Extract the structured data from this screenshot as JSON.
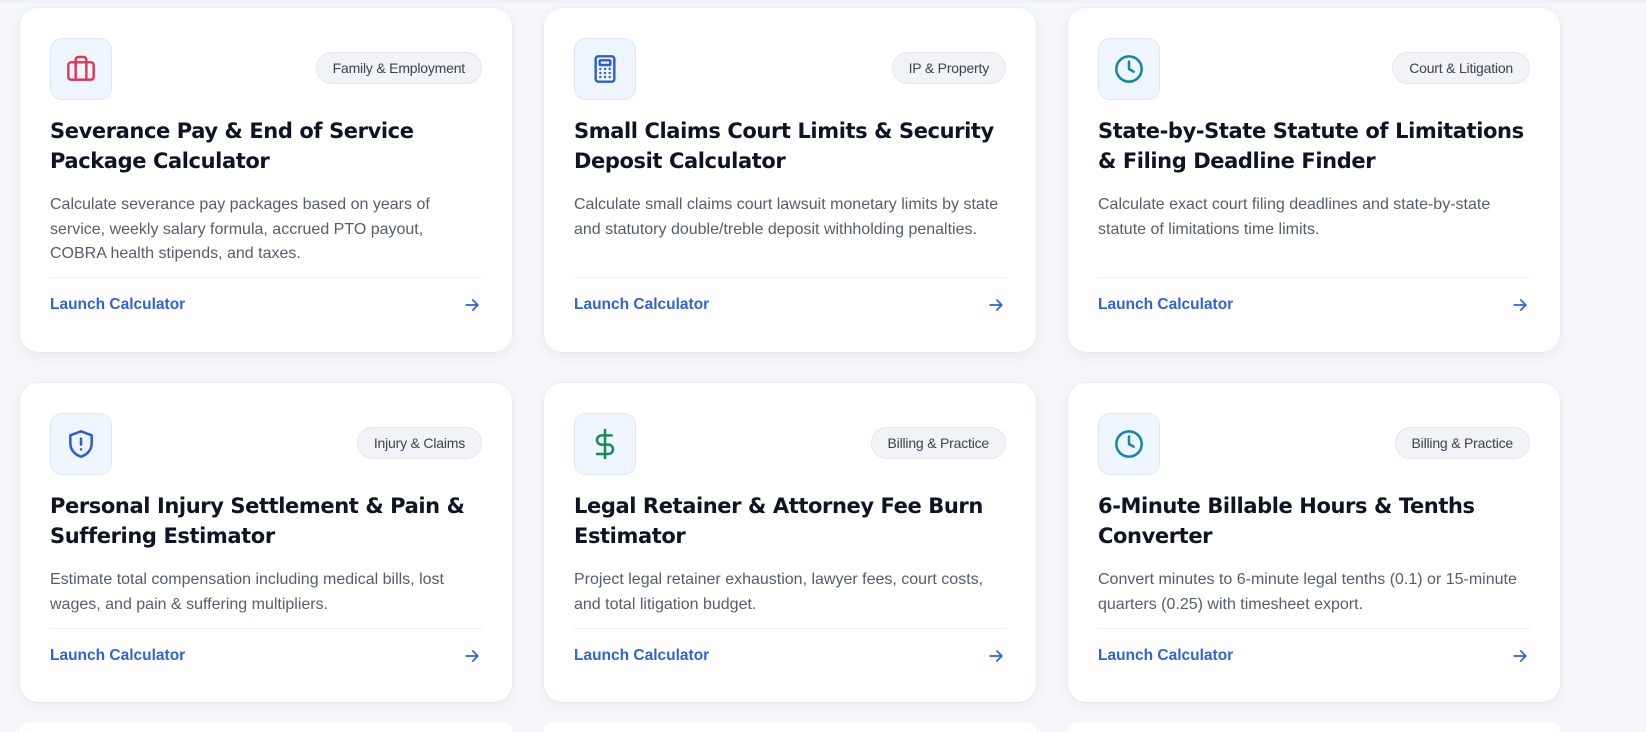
{
  "colors": {
    "accent": "#2f63d6",
    "icon_red": "#e0344f",
    "icon_blue": "#2b5fcf",
    "icon_teal": "#1387a5",
    "icon_green": "#1b8a5a"
  },
  "cards": [
    {
      "icon": "briefcase-icon",
      "badge": "Family & Employment",
      "title": "Severance Pay & End of Service Package Calculator",
      "description": "Calculate severance pay packages based on years of service, weekly salary formula, accrued PTO payout, COBRA health stipends, and taxes.",
      "link": "Launch Calculator"
    },
    {
      "icon": "calculator-icon",
      "badge": "IP & Property",
      "title": "Small Claims Court Limits & Security Deposit Calculator",
      "description": "Calculate small claims court lawsuit monetary limits by state and statutory double/treble deposit withholding penalties.",
      "link": "Launch Calculator"
    },
    {
      "icon": "clock-icon",
      "badge": "Court & Litigation",
      "title": "State-by-State Statute of Limitations & Filing Deadline Finder",
      "description": "Calculate exact court filing deadlines and state-by-state statute of limitations time limits.",
      "link": "Launch Calculator"
    },
    {
      "icon": "shield-alert-icon",
      "badge": "Injury & Claims",
      "title": "Personal Injury Settlement & Pain & Suffering Estimator",
      "description": "Estimate total compensation including medical bills, lost wages, and pain & suffering multipliers.",
      "link": "Launch Calculator"
    },
    {
      "icon": "dollar-icon",
      "badge": "Billing & Practice",
      "title": "Legal Retainer & Attorney Fee Burn Estimator",
      "description": "Project legal retainer exhaustion, lawyer fees, court costs, and total litigation budget.",
      "link": "Launch Calculator"
    },
    {
      "icon": "clock-icon",
      "badge": "Billing & Practice",
      "title": "6-Minute Billable Hours & Tenths Converter",
      "description": "Convert minutes to 6-minute legal tenths (0.1) or 15-minute quarters (0.25) with timesheet export.",
      "link": "Launch Calculator"
    }
  ]
}
